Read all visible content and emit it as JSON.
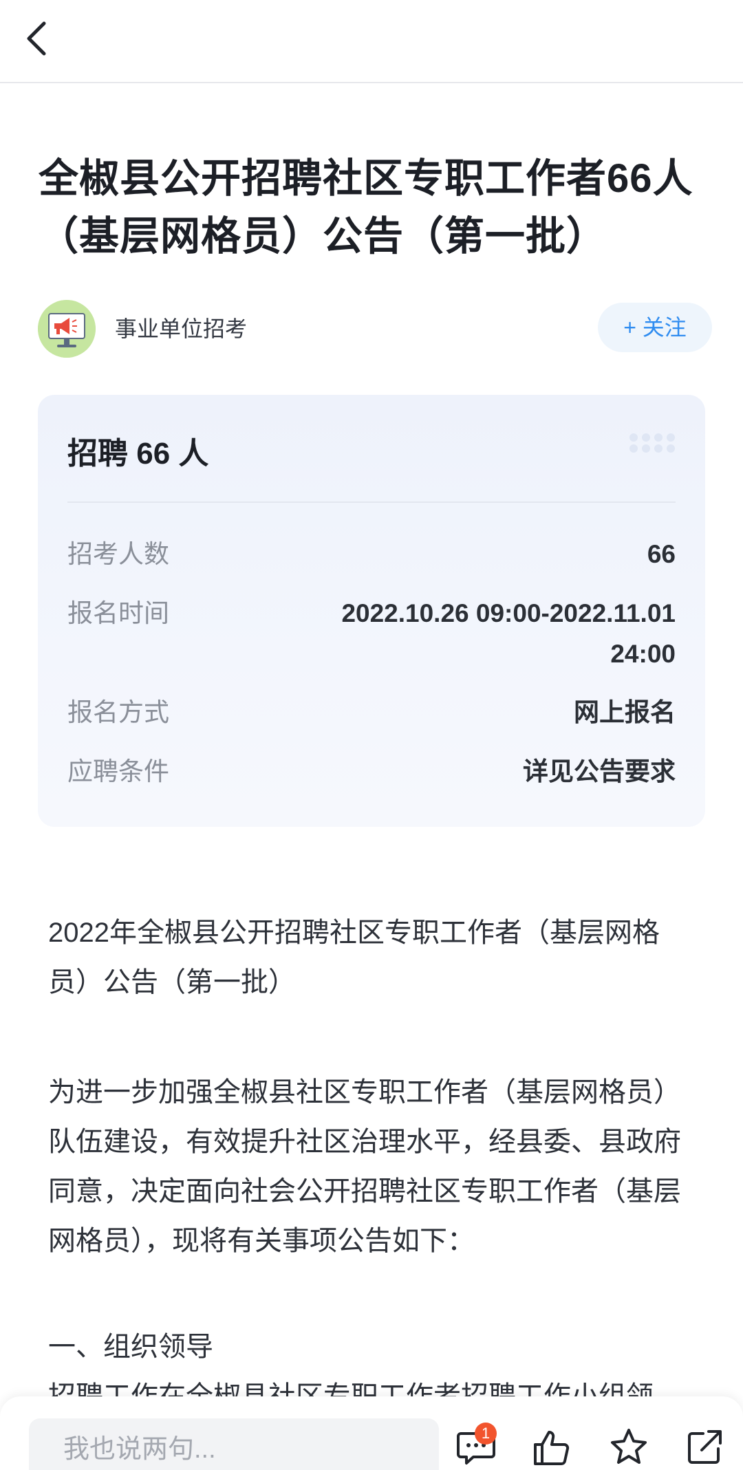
{
  "nav": {
    "back_icon": "chevron-left-icon"
  },
  "article_title": "全椒县公开招聘社区专职工作者66人（基层网格员）公告（第一批）",
  "author": {
    "name": "事业单位招考",
    "avatar_icon": "megaphone-icon",
    "follow_label": "+ 关注"
  },
  "card": {
    "title": "招聘 66 人",
    "rows": [
      {
        "label": "招考人数",
        "value": "66"
      },
      {
        "label": "报名时间",
        "value": "2022.10.26 09:00-2022.11.01",
        "value2": "24:00"
      },
      {
        "label": "报名方式",
        "value": "网上报名"
      },
      {
        "label": "应聘条件",
        "value": "详见公告要求"
      }
    ]
  },
  "article": {
    "heading": "2022年全椒县公开招聘社区专职工作者（基层网格员）公告（第一批）",
    "intro": "为进一步加强全椒县社区专职工作者（基层网格员）队伍建设，有效提升社区治理水平，经县委、县政府同意，决定面向社会公开招聘社区专职工作者（基层网格员），现将有关事项公告如下：",
    "section1_title": "一、组织领导",
    "section1_partial": "招聘工作在全椒县社区专职工作者招聘工作小组领"
  },
  "bottom_bar": {
    "comment_placeholder": "我也说两句...",
    "comment_badge": "1",
    "icons": [
      "comment-icon",
      "thumbs-up-icon",
      "star-icon",
      "share-icon"
    ]
  },
  "colors": {
    "accent": "#2f8cf0",
    "badge": "#f2542d",
    "card_bg": "#eef2fb"
  }
}
